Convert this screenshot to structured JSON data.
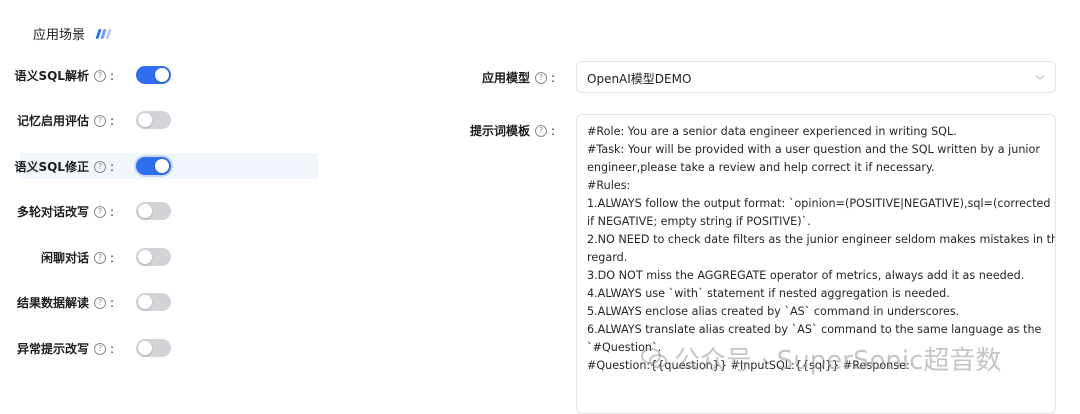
{
  "section": {
    "title": "应用场景"
  },
  "colors": {
    "accent": "#2f6fef",
    "toggle_off": "#d4d4d8",
    "deco": [
      "#2f6fef",
      "#6f9af5",
      "#b7cbf8"
    ]
  },
  "settings": [
    {
      "label": "语义SQL解析",
      "enabled": true
    },
    {
      "label": "记忆启用评估",
      "enabled": false
    },
    {
      "label": "语义SQL修正",
      "enabled": true,
      "highlighted": true
    },
    {
      "label": "多轮对话改写",
      "enabled": false
    },
    {
      "label": "闲聊对话",
      "enabled": false
    },
    {
      "label": "结果数据解读",
      "enabled": false
    },
    {
      "label": "异常提示改写",
      "enabled": false
    }
  ],
  "model": {
    "label": "应用模型",
    "value": "OpenAI模型DEMO"
  },
  "prompt": {
    "label": "提示词模板",
    "lines": [
      "#Role: You are a senior data engineer experienced in writing SQL.",
      "#Task: Your will be provided with a user question and the SQL written by a junior",
      "engineer,please take a review and help correct it if necessary.",
      "#Rules:",
      "1.ALWAYS follow the output format: `opinion=(POSITIVE|NEGATIVE),sql=(corrected sql",
      "if NEGATIVE; empty string if POSITIVE)`.",
      "2.NO NEED to check date filters as the junior engineer seldom makes mistakes in this",
      "regard.",
      "3.DO NOT miss the AGGREGATE operator of metrics, always add it as needed.",
      "4.ALWAYS use `with` statement if nested aggregation is needed.",
      "5.ALWAYS enclose alias created by `AS` command in underscores.",
      "6.ALWAYS translate alias created by `AS` command to the same language as the",
      "`#Question`.",
      "#Question:{{question}} #InputSQL:{{sql}} #Response:"
    ]
  },
  "watermark": {
    "text": "公众号 · SuperSonic超音数"
  },
  "icons": {
    "help": "question-circle-icon",
    "dropdown": "chevron-down-icon"
  }
}
